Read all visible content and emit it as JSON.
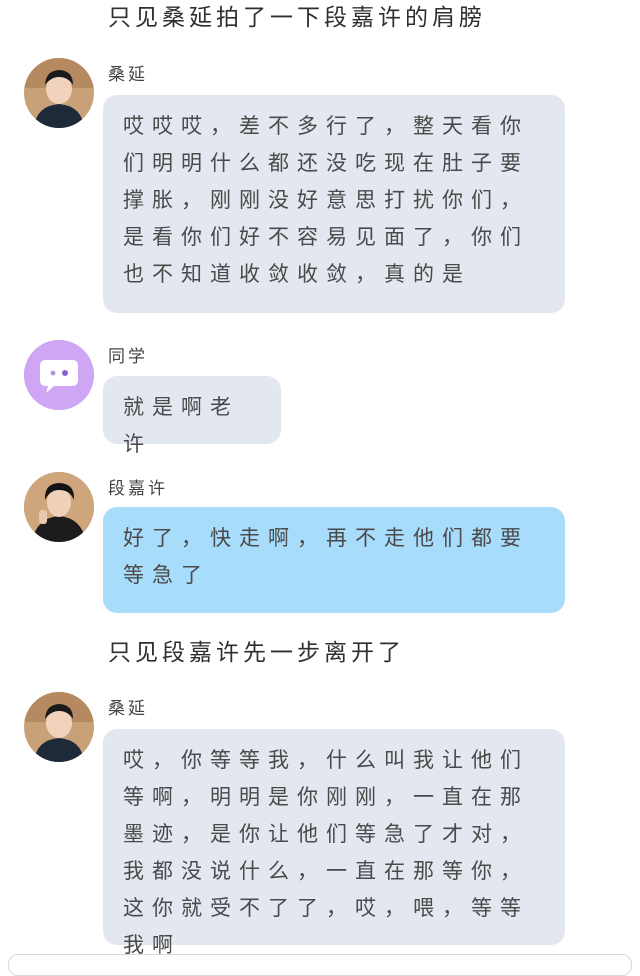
{
  "chat": {
    "narration_top": "只见桑延拍了一下段嘉许的肩膀",
    "msg1": {
      "name": "桑延",
      "text": "哎哎哎，差不多行了，整天看你们明明什么都还没吃现在肚子要撑胀，刚刚没好意思打扰你们，是看你们好不容易见面了，你们也不知道收敛收敛，真的是"
    },
    "msg2": {
      "name": "同学",
      "text": "就是啊老许"
    },
    "msg3": {
      "name": "段嘉许",
      "text": "好了，快走啊，再不走他们都要等急了"
    },
    "narration_mid": "只见段嘉许先一步离开了",
    "msg4": {
      "name": "桑延",
      "text": "哎，你等等我，什么叫我让他们等啊，明明是你刚刚，一直在那墨迹，是你让他们等急了才对，我都没说什么，一直在那等你，这你就受不了了，哎，喂，等等我啊"
    }
  },
  "colors": {
    "gray_bubble": "#e3e7ef",
    "blue_bubble": "#a8dcfb",
    "purple_avatar": "#cfa6f3"
  },
  "icons": {
    "avatar_sangyan": "person-avatar",
    "avatar_tongxue": "chat-bubble-icon",
    "avatar_duanjiaxu": "person-avatar"
  }
}
